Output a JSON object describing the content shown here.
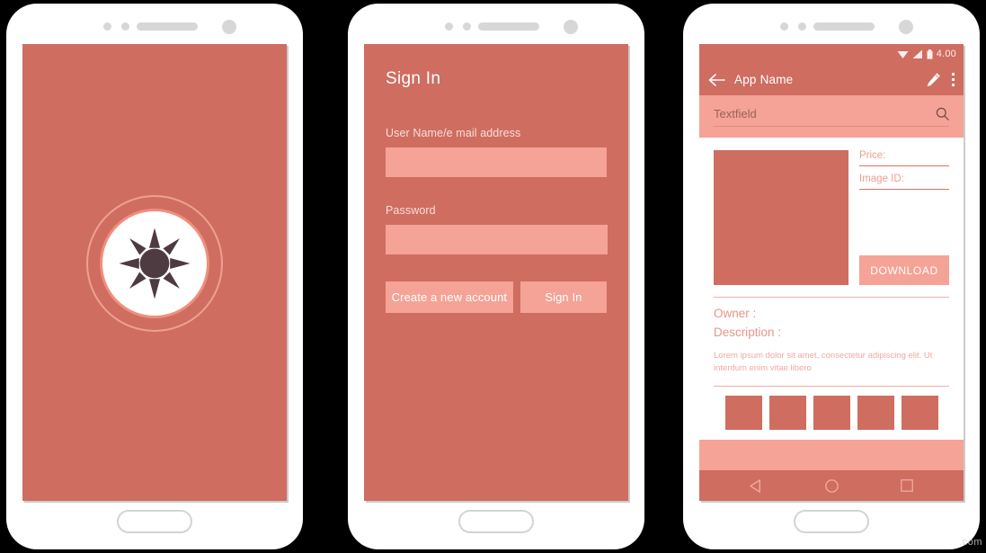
{
  "meta": {
    "watermark": ".com",
    "colors": {
      "coral": "#cf6d60",
      "coral_light": "#f4a396",
      "white": "#ffffff",
      "frame_grey": "#d7d7d7",
      "dark_sun": "#4e3b42"
    }
  },
  "phone_1": {
    "name": "splash-screen",
    "logo_icon": "sun-icon"
  },
  "phone_2": {
    "name": "sign-in-screen",
    "title": "Sign In",
    "username": {
      "label": "User Name/e mail address",
      "value": "",
      "placeholder": ""
    },
    "password": {
      "label": "Password",
      "value": "",
      "placeholder": ""
    },
    "buttons": {
      "create_account": "Create a new account",
      "sign_in": "Sign In"
    }
  },
  "phone_3": {
    "name": "app-detail-screen",
    "statusbar": {
      "time": "4.00",
      "icons": [
        "wifi-icon",
        "signal-icon",
        "battery-icon"
      ]
    },
    "appbar": {
      "back_icon": "back-arrow-icon",
      "title": "App Name",
      "edit_icon": "pencil-icon",
      "menu_icon": "kebab-menu-icon"
    },
    "search": {
      "placeholder": "Textfield",
      "value": "",
      "icon": "search-icon"
    },
    "detail": {
      "image_placeholder": "product-image",
      "price_label": "Price:",
      "price_value": "",
      "image_id_label": "Image ID:",
      "image_id_value": "",
      "download_label": "DOWNLOAD"
    },
    "info": {
      "owner_label": "Owner :",
      "description_label": "Description :",
      "description_body": "Lorem ipsum dolor sit amet, consectetur adipiscing elit. Ut interdum enim vitae libero"
    },
    "thumbnails": [
      {
        "name": "thumbnail-1"
      },
      {
        "name": "thumbnail-2"
      },
      {
        "name": "thumbnail-3"
      },
      {
        "name": "thumbnail-4"
      },
      {
        "name": "thumbnail-5"
      }
    ],
    "navbar": {
      "back_icon": "nav-back-triangle-icon",
      "home_icon": "nav-home-circle-icon",
      "recents_icon": "nav-recents-square-icon"
    }
  }
}
